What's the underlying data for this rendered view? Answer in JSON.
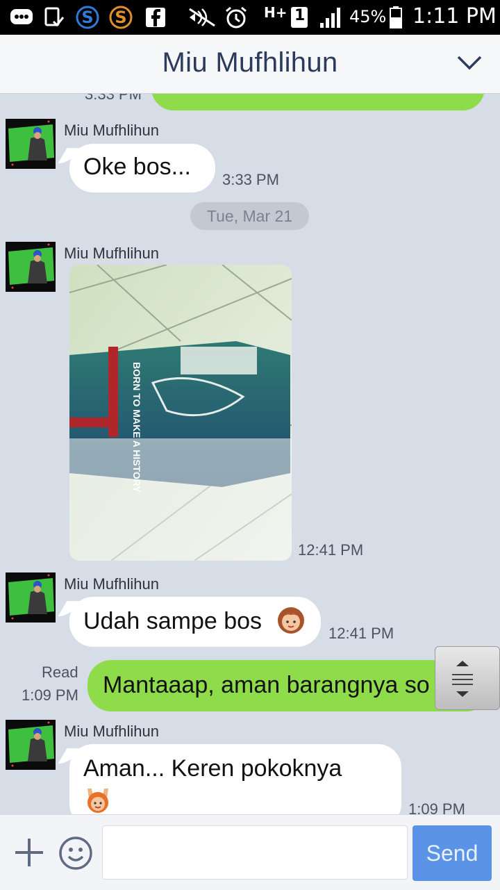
{
  "status_bar": {
    "battery": "45%",
    "time": "1:11 PM",
    "network": "H+",
    "sim": "1",
    "icons": [
      "messenger-icon",
      "screenshot-icon",
      "s-blue-icon",
      "s-orange-icon",
      "facebook-icon",
      "mute-icon",
      "alarm-icon",
      "network-icon",
      "signal-icon",
      "battery-icon"
    ]
  },
  "header": {
    "title": "Miu Mufhlihun"
  },
  "messages": {
    "partial_top": {
      "time": "3:33 PM"
    },
    "m1": {
      "sender": "Miu Mufhlihun",
      "text": "Oke bos...",
      "time": "3:33 PM"
    },
    "date_separator": "Tue, Mar 21",
    "m2": {
      "sender": "Miu Mufhlihun",
      "time": "12:41 PM",
      "photo_text": "BORN TO MAKE A HISTORY"
    },
    "m3": {
      "sender": "Miu Mufhlihun",
      "text": "Udah sampe bos",
      "time": "12:41 PM"
    },
    "m4": {
      "status": "Read",
      "time": "1:09 PM",
      "text": "Mantaaap, aman barangnya so"
    },
    "m5": {
      "sender": "Miu Mufhlihun",
      "text": "Aman... Keren pokoknya",
      "time": "1:09 PM"
    }
  },
  "composer": {
    "send_label": "Send",
    "placeholder": ""
  },
  "colors": {
    "outgoing_bubble": "#8fdc4a",
    "background": "#d7dde7",
    "send_button": "#5b94e6",
    "header_text": "#2c3a5c"
  }
}
